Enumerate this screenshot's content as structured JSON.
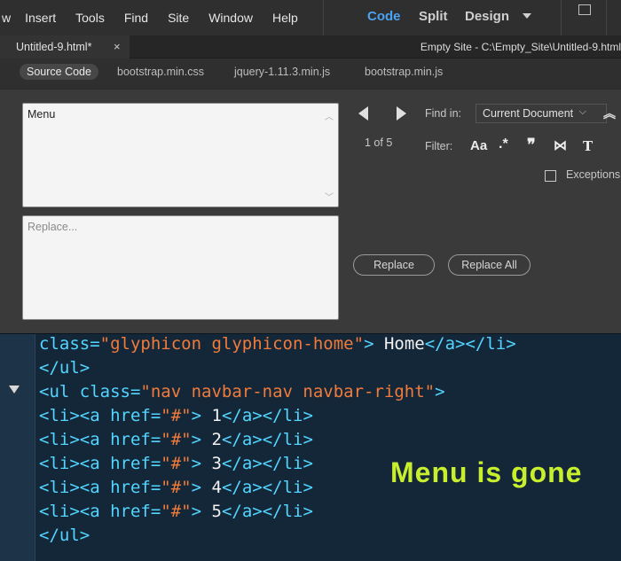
{
  "menubar": {
    "items": [
      "w",
      "Insert",
      "Tools",
      "Find",
      "Site",
      "Window",
      "Help"
    ],
    "modes": {
      "code": "Code",
      "split": "Split",
      "design": "Design"
    }
  },
  "tabs": {
    "document": "Untitled-9.html*",
    "close": "×",
    "site_path": "Empty Site - C:\\Empty_Site\\Untitled-9.html"
  },
  "related_files": [
    "Source Code",
    "bootstrap.min.css",
    "jquery-1.11.3.min.js",
    "bootstrap.min.js"
  ],
  "find": {
    "search_text": "Menu",
    "replace_placeholder": "Replace...",
    "match_count": "1 of 5",
    "find_in_label": "Find in:",
    "find_in_value": "Current Document",
    "filter_label": "Filter:",
    "filter_icons": [
      "Aa",
      ".*",
      "❞",
      "⋈",
      "T"
    ],
    "replace_button": "Replace",
    "replace_all_button": "Replace All",
    "exceptions_label": "Exceptions"
  },
  "code": {
    "line1": {
      "a": "class=",
      "b": "\"glyphicon glyphicon-home\"",
      "c": "> ",
      "d": "Home",
      "e": "</a></li>"
    },
    "line2": "</ul>",
    "line3": {
      "a": "<ul class=",
      "b": "\"nav navbar-nav navbar-right\"",
      "c": ">"
    },
    "li_lines": [
      {
        "open": "<li><a href=",
        "href": "\"#\"",
        "gt": "> ",
        "num": "1",
        "close": "</a></li>"
      },
      {
        "open": "<li><a href=",
        "href": "\"#\"",
        "gt": "> ",
        "num": "2",
        "close": "</a></li>"
      },
      {
        "open": "<li><a href=",
        "href": "\"#\"",
        "gt": "> ",
        "num": "3",
        "close": "</a></li>"
      },
      {
        "open": "<li><a href=",
        "href": "\"#\"",
        "gt": "> ",
        "num": "4",
        "close": "</a></li>"
      },
      {
        "open": "<li><a href=",
        "href": "\"#\"",
        "gt": "> ",
        "num": "5",
        "close": "</a></li>"
      }
    ],
    "line_end": "</ul>"
  },
  "annotation": "Menu is gone",
  "colors": {
    "accent": "#4aa3f0",
    "code_bg": "#142739",
    "annotation": "#c8ef2e",
    "tag": "#52d5ff",
    "string": "#f07b3a"
  }
}
